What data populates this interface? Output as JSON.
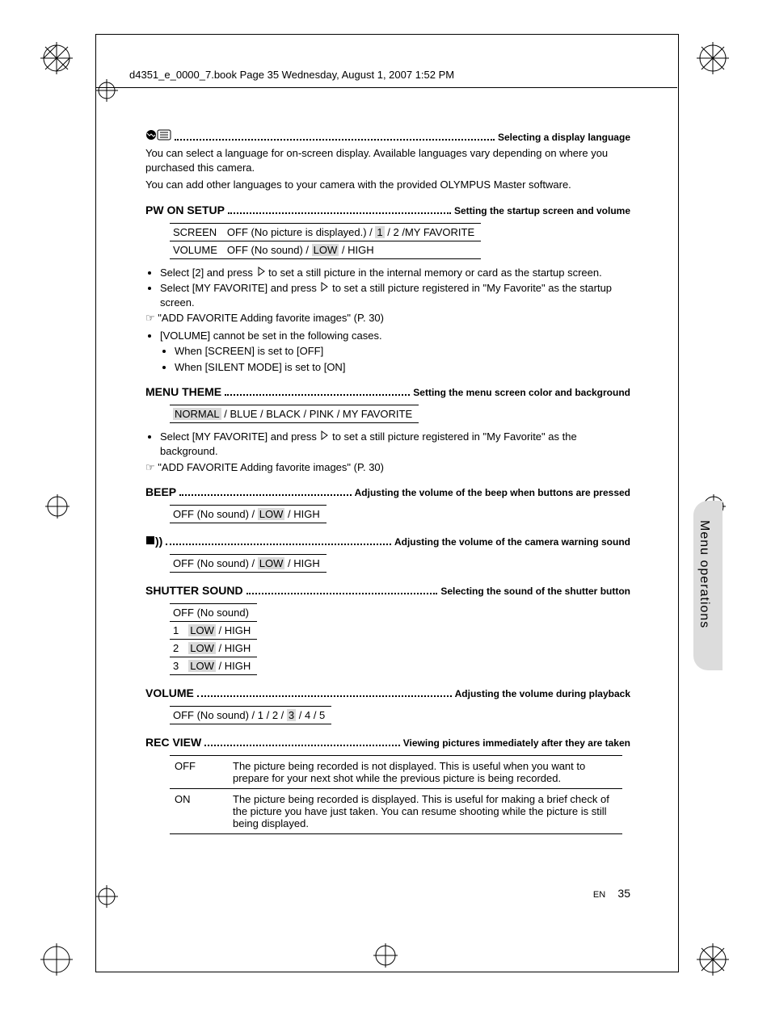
{
  "header": "d4351_e_0000_7.book  Page 35  Wednesday, August 1, 2007  1:52 PM",
  "sections": {
    "lang": {
      "desc": "Selecting a display language",
      "body1": "You can select a language for on-screen display. Available languages vary depending on where you purchased this camera.",
      "body2": "You can add other languages to your camera with the provided OLYMPUS Master software."
    },
    "pwon": {
      "label": "PW ON SETUP",
      "desc": "Setting the startup screen and volume",
      "row1_label": "SCREEN",
      "row1_opts_a": "OFF (No picture is displayed.) /",
      "row1_opts_b": "1",
      "row1_opts_c": "/   2  /MY FAVORITE",
      "row2_label": "VOLUME",
      "row2_opts_a": "OFF (No sound) /",
      "row2_opts_b": "LOW",
      "row2_opts_c": "/ HIGH",
      "bullet1_a": "Select [2] and press ",
      "bullet1_b": " to set a still picture in the internal memory or card as the startup screen.",
      "bullet2_a": "Select [MY FAVORITE] and press ",
      "bullet2_b": " to set a still picture registered in \"My Favorite\" as the startup screen.",
      "ref": "\"ADD FAVORITE Adding favorite images\" (P. 30)",
      "bullet3": "[VOLUME] cannot be set in the following cases.",
      "sub1": "When [SCREEN] is set to [OFF]",
      "sub2": "When [SILENT MODE] is set to [ON]"
    },
    "theme": {
      "label": "MENU THEME",
      "desc": "Setting the menu screen color and background",
      "opts_a": "NORMAL",
      "opts_b": "/ BLUE    / BLACK  / PINK     / MY FAVORITE",
      "bullet_a": "Select [MY FAVORITE] and press ",
      "bullet_b": " to set a still picture registered in \"My Favorite\" as the background.",
      "ref": "\"ADD FAVORITE Adding favorite images\" (P. 30)"
    },
    "beep": {
      "label": "BEEP",
      "desc": "Adjusting the volume of the beep when buttons are pressed",
      "opts_a": "OFF (No sound) /",
      "opts_b": "LOW",
      "opts_c": "/ HIGH"
    },
    "warn": {
      "desc": "Adjusting the volume of the camera warning sound",
      "opts_a": "OFF (No sound) /",
      "opts_b": "LOW",
      "opts_c": "/ HIGH"
    },
    "shutter": {
      "label": "SHUTTER SOUND",
      "desc": "Selecting the sound of the shutter button",
      "row0": "OFF (No sound)",
      "r1": "1",
      "r2": "2",
      "r3": "3",
      "low": "LOW",
      "rest": "/ HIGH"
    },
    "volume": {
      "label": "VOLUME",
      "desc": "Adjusting the volume during playback",
      "opts_a": "OFF (No sound) /  1 / 2 /",
      "opts_b": "3",
      "opts_c": "/ 4 / 5"
    },
    "recview": {
      "label": "REC VIEW",
      "desc": "Viewing pictures immediately after they are taken",
      "off": "OFF",
      "off_desc": "The picture being recorded is not displayed. This is useful when you want to prepare for your next shot while the previous picture is being recorded.",
      "on": "ON",
      "on_desc": "The picture being recorded is displayed. This is useful for making a brief check of the picture you have just taken. You can resume shooting while the picture is still being displayed."
    }
  },
  "side_label": "Menu operations",
  "footer_lang": "EN",
  "page_number": "35"
}
